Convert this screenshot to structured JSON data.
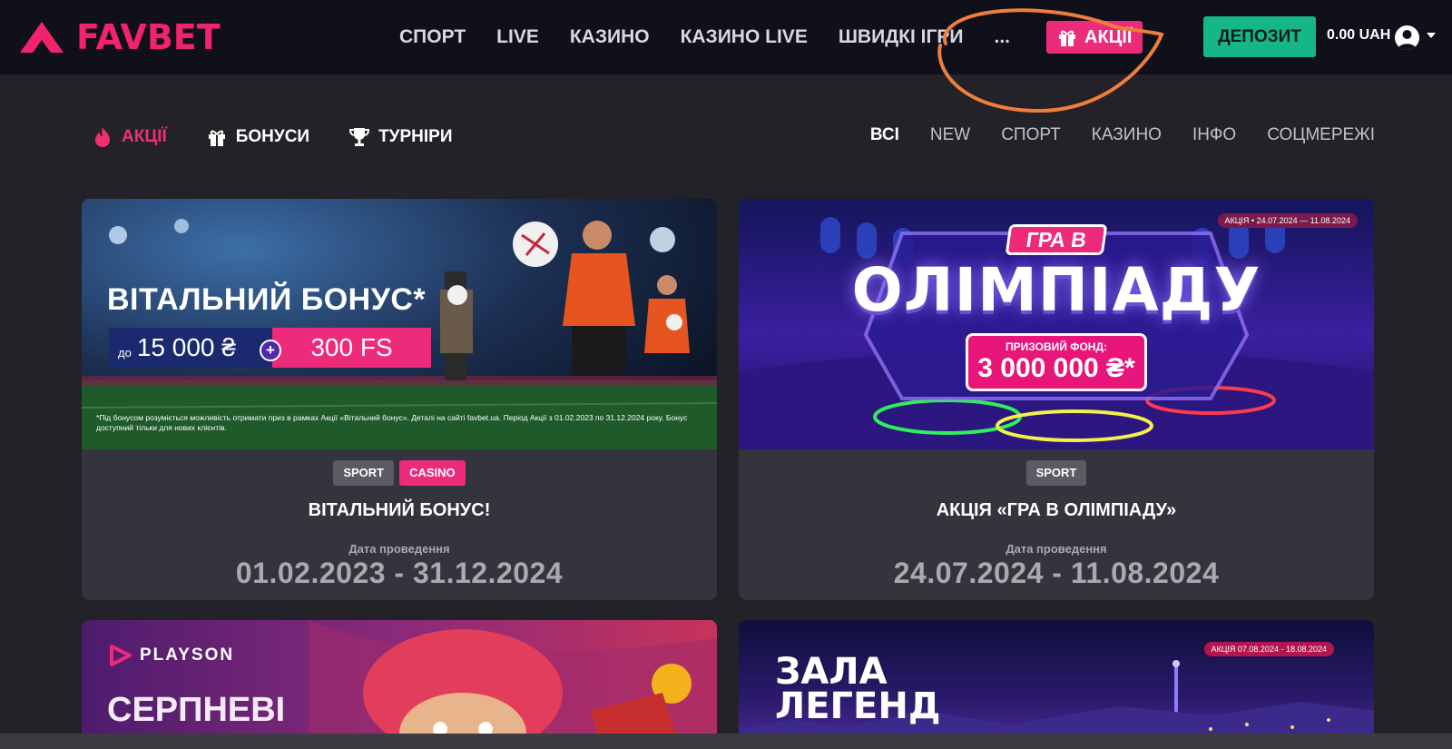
{
  "header": {
    "logo_text": "FAVBET",
    "nav": [
      "СПОРТ",
      "LIVE",
      "КАЗИНО",
      "КАЗИНО LIVE",
      "ШВИДКІ ІГРИ"
    ],
    "more": "...",
    "promo_label": "АКЦІЇ",
    "deposit_label": "ДЕПОЗИТ",
    "balance": "0.00 UAH"
  },
  "subnav": {
    "tabs": [
      "АКЦІЇ",
      "БОНУСИ",
      "ТУРНІРИ"
    ],
    "filters": [
      "ВСІ",
      "NEW",
      "СПОРТ",
      "КАЗИНО",
      "ІНФО",
      "СОЦМЕРЕЖІ"
    ],
    "active_filter": "ВСІ"
  },
  "cards": [
    {
      "banner": {
        "title": "ВІТАЛЬНИЙ БОНУС*",
        "prefix": "до",
        "amount": "15 000 ₴",
        "plus": "+",
        "fs": "300 FS",
        "note": "*Під бонусом розуміється можливість отримати приз в рамках Акції «Вітальний бонус». Деталі на сайті favbet.ua. Період Акції з 01.02.2023 по 31.12.2024 року. Бонус доступний тільки для нових клієнтів."
      },
      "tags": [
        "SPORT",
        "CASINO"
      ],
      "title": "ВІТАЛЬНИЙ БОНУС!",
      "date_label": "Дата проведення",
      "dates": "01.02.2023 - 31.12.2024"
    },
    {
      "banner": {
        "badge": "АКЦІЯ • 24.07.2024 — 11.08.2024",
        "small": "ГРА В",
        "big": "ОЛІМПІАДУ",
        "fund_label": "ПРИЗОВИЙ ФОНД:",
        "fund_value": "3 000 000 ₴*"
      },
      "tags": [
        "SPORT"
      ],
      "title": "АКЦІЯ «ГРА В ОЛІМПІАДУ»",
      "date_label": "Дата проведення",
      "dates": "24.07.2024 - 11.08.2024"
    },
    {
      "banner": {
        "brand": "PLAYSON",
        "title": "СЕРПНЕВІ"
      }
    },
    {
      "banner": {
        "badge": "АКЦІЯ 07.08.2024 - 18.08.2024",
        "title1": "ЗАЛА",
        "title2": "ЛЕГЕНД"
      }
    }
  ]
}
